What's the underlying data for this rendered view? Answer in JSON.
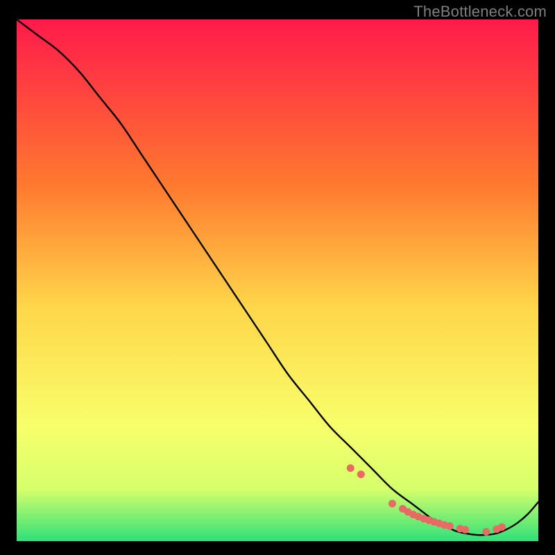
{
  "watermark": "TheBottleneck.com",
  "chart_data": {
    "type": "line",
    "title": "",
    "xlabel": "",
    "ylabel": "",
    "xlim": [
      0,
      100
    ],
    "ylim": [
      0,
      100
    ],
    "grid": false,
    "legend": false,
    "background_gradient": {
      "top": "#ff1a4b",
      "mid_upper": "#ff7a2f",
      "mid": "#ffd64a",
      "mid_lower": "#f8ff6b",
      "band": "#d6ff6b",
      "bottom": "#2fe07a"
    },
    "series": [
      {
        "name": "curve",
        "color": "#000000",
        "x": [
          0,
          4,
          8,
          12,
          16,
          20,
          24,
          28,
          32,
          36,
          40,
          44,
          48,
          52,
          56,
          60,
          64,
          68,
          72,
          76,
          80,
          82,
          84,
          86,
          88,
          90,
          92,
          94,
          96,
          98,
          100
        ],
        "y": [
          100,
          97,
          94,
          90,
          85,
          80,
          74,
          68,
          62,
          56,
          50,
          44,
          38,
          32,
          27,
          22,
          18,
          14,
          10,
          7,
          4,
          3,
          2,
          1.5,
          1.2,
          1.2,
          1.5,
          2.3,
          3.5,
          5.2,
          7.5
        ]
      }
    ],
    "points": {
      "name": "dense-markers",
      "color": "#e86a65",
      "approx_count": 18,
      "x": [
        64,
        66,
        72,
        74,
        75,
        76,
        77,
        78,
        79,
        80,
        81,
        82,
        83,
        85,
        86,
        90,
        92,
        93
      ],
      "y": [
        14,
        12.8,
        7.2,
        6.2,
        5.6,
        5.1,
        4.7,
        4.3,
        4.0,
        3.7,
        3.4,
        3.1,
        2.9,
        2.4,
        2.2,
        1.8,
        2.3,
        2.7
      ]
    }
  }
}
